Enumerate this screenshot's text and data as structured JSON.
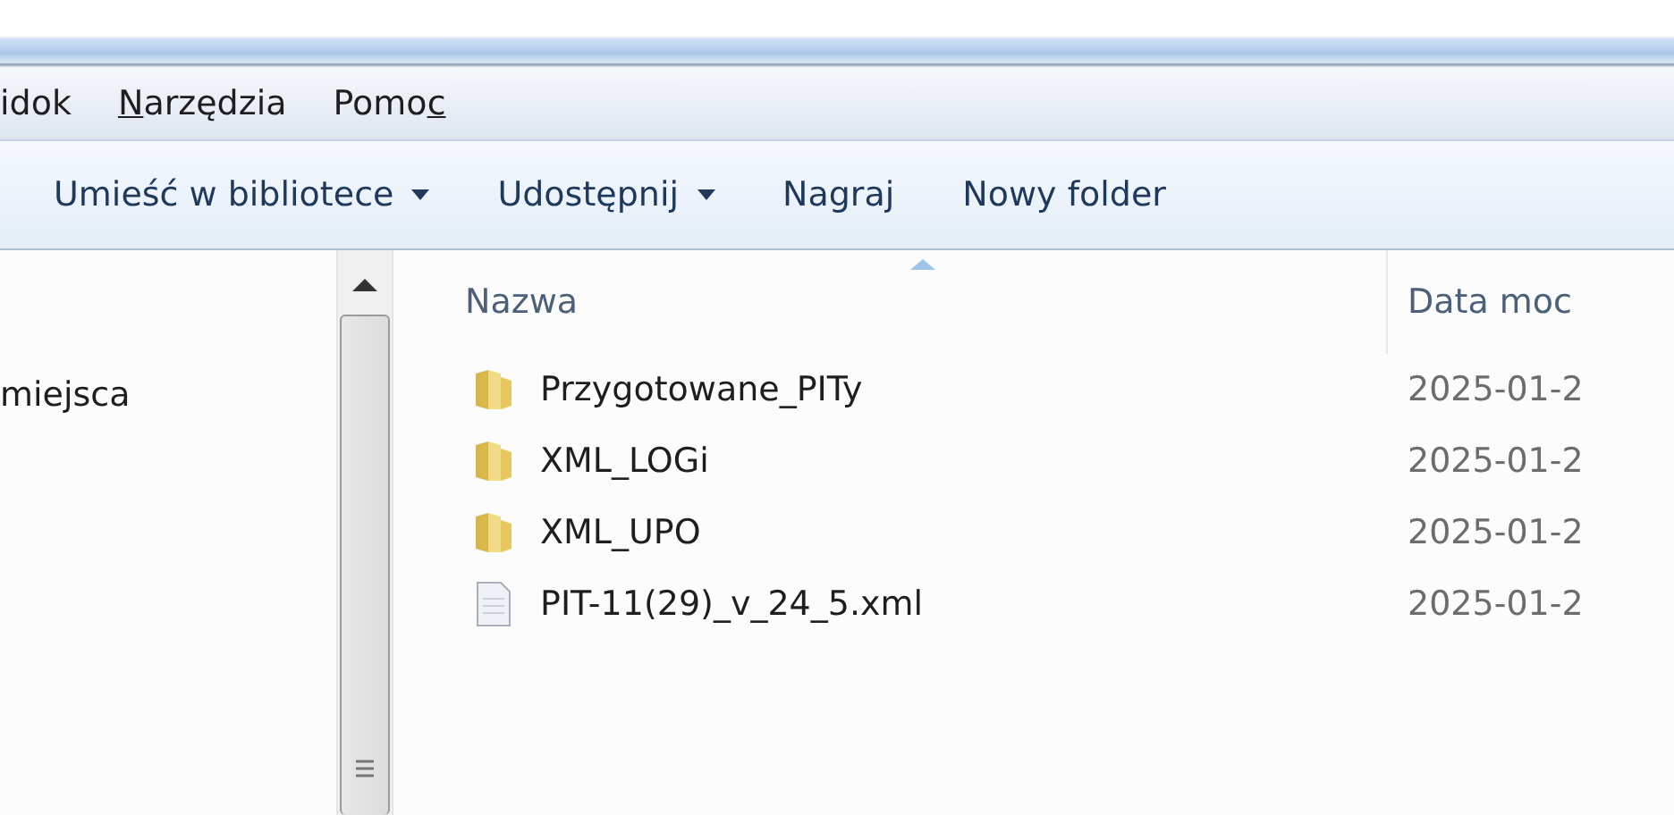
{
  "menu_bar": {
    "items": [
      {
        "before": "idok"
      },
      {
        "key": "N",
        "after": "arzędzia"
      },
      {
        "before": "Pomo",
        "key": "c"
      }
    ]
  },
  "toolbar": {
    "items": [
      {
        "label": "Umieść w bibliotece",
        "has_dropdown": true
      },
      {
        "label": "Udostępnij",
        "has_dropdown": true
      },
      {
        "label": "Nagraj",
        "has_dropdown": false
      },
      {
        "label": "Nowy folder",
        "has_dropdown": false
      }
    ]
  },
  "navigation_pane": {
    "items": [
      "miejsca"
    ]
  },
  "file_list": {
    "columns": [
      {
        "label": "Nazwa",
        "sorted": true
      },
      {
        "label": "Data moc",
        "sorted": false
      }
    ],
    "rows": [
      {
        "kind": "folder",
        "name": "Przygotowane_PITy",
        "date": "2025-01-2"
      },
      {
        "kind": "folder",
        "name": "XML_LOGi",
        "date": "2025-01-2"
      },
      {
        "kind": "folder",
        "name": "XML_UPO",
        "date": "2025-01-2"
      },
      {
        "kind": "file",
        "name": "PIT-11(29)_v_24_5.xml",
        "date": "2025-01-2"
      }
    ]
  }
}
